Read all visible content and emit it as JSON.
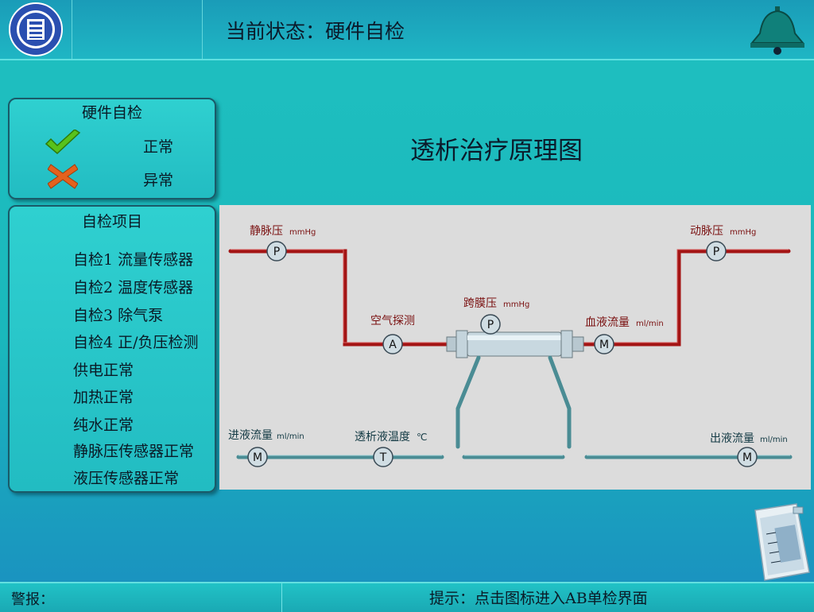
{
  "header": {
    "status_title": "当前状态：硬件自检"
  },
  "legend_panel": {
    "title": "硬件自检",
    "normal_label": "正常",
    "abnormal_label": "异常"
  },
  "items_panel": {
    "title": "自检项目",
    "items": [
      "自检1 流量传感器",
      "自检2 温度传感器",
      "自检3 除气泵",
      "自检4 正/负压检测",
      "供电正常",
      "加热正常",
      "纯水正常",
      "静脉压传感器正常",
      "液压传感器正常"
    ]
  },
  "diagram": {
    "title": "透析治疗原理图",
    "labels": {
      "venous_pressure": "静脉压",
      "arterial_pressure": "动脉压",
      "air_detect": "空气探测",
      "tmp": "跨膜压",
      "blood_flow": "血液流量",
      "inflow": "进液流量",
      "dialysate_temp": "透析液温度",
      "outflow": "出液流量"
    },
    "units": {
      "mmhg": "mmHg",
      "ml_min": "ml/min",
      "celsius": "℃"
    },
    "gauges": {
      "p": "P",
      "a": "A",
      "m": "M",
      "t": "T"
    }
  },
  "footer": {
    "alarm_label": "警报：",
    "hint": "提示：点击图标进入AB单检界面"
  },
  "colors": {
    "blood_line": "#a31414",
    "fluid_line": "#4a8c94",
    "ok_icon": "#58c21c",
    "error_icon": "#e3621e"
  },
  "icons": [
    "logo-emblem",
    "alarm-bell-icon",
    "check-icon",
    "cross-icon",
    "dialysate-bag-icon"
  ]
}
